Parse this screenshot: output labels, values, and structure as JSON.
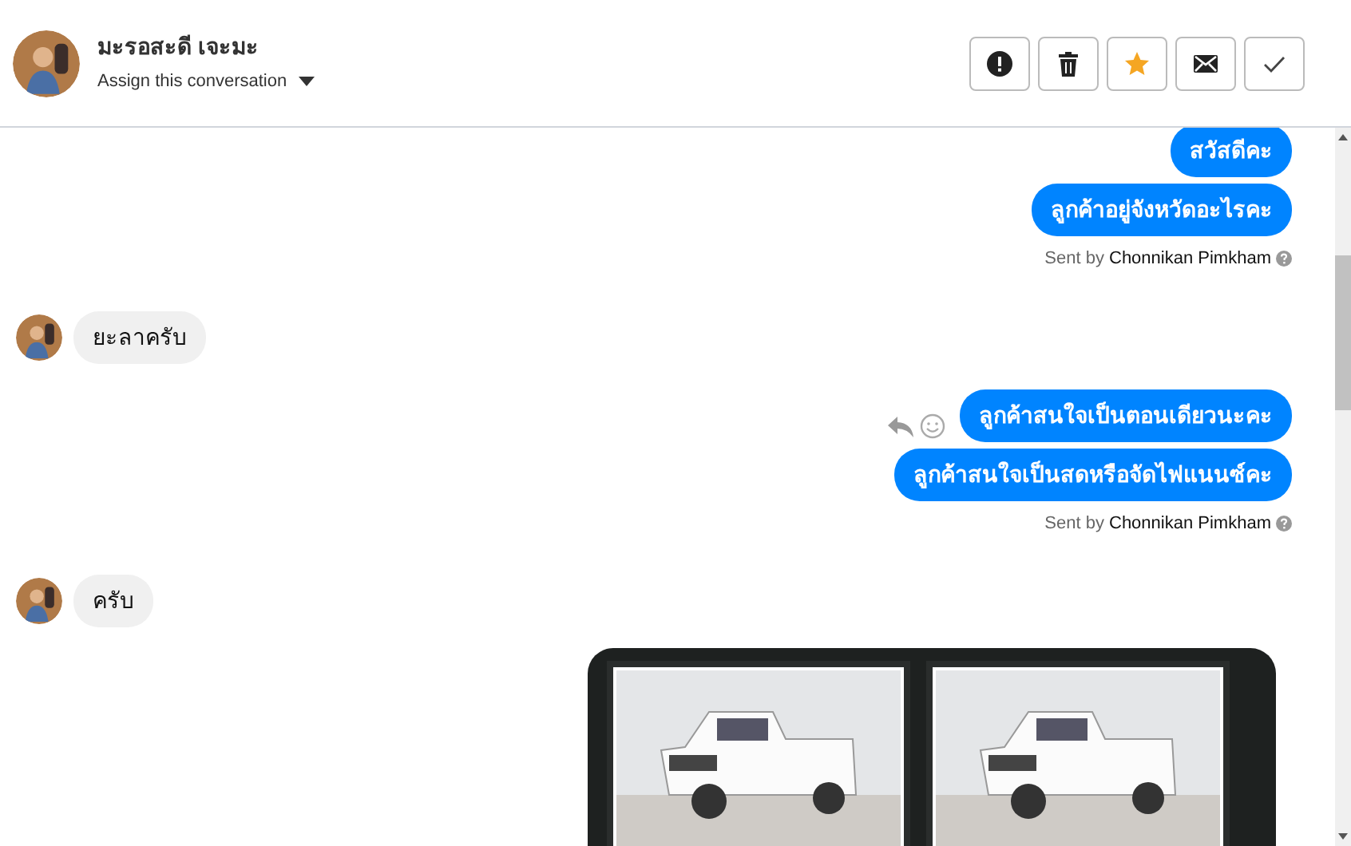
{
  "header": {
    "contact_name": "มะรอสะดี เจะมะ",
    "assign_label": "Assign this conversation",
    "actions": [
      {
        "kind": "report"
      },
      {
        "kind": "delete"
      },
      {
        "kind": "star",
        "on": true
      },
      {
        "kind": "mail"
      },
      {
        "kind": "done"
      }
    ]
  },
  "messages": [
    {
      "kind": "outgoing",
      "text": "สวัสดีคะ",
      "hover": false
    },
    {
      "kind": "outgoing",
      "text": "ลูกค้าอยู่จังหวัดอะไรคะ",
      "hover": false
    },
    {
      "kind": "sent_by",
      "prefix": "Sent by",
      "sender": "Chonnikan Pimkham"
    },
    {
      "kind": "incoming",
      "text": "ยะลาครับ"
    },
    {
      "kind": "outgoing",
      "text": "ลูกค้าสนใจเป็นตอนเดียวนะคะ",
      "hover": true
    },
    {
      "kind": "outgoing",
      "text": "ลูกค้าสนใจเป็นสดหรือจัดไฟแนนซ์คะ",
      "hover": false
    },
    {
      "kind": "sent_by",
      "prefix": "Sent by",
      "sender": "Chonnikan Pimkham"
    },
    {
      "kind": "incoming",
      "text": "ครับ"
    },
    {
      "kind": "product_card",
      "products": [
        {
          "kind": "photo"
        },
        {
          "kind": "photo"
        }
      ]
    }
  ]
}
